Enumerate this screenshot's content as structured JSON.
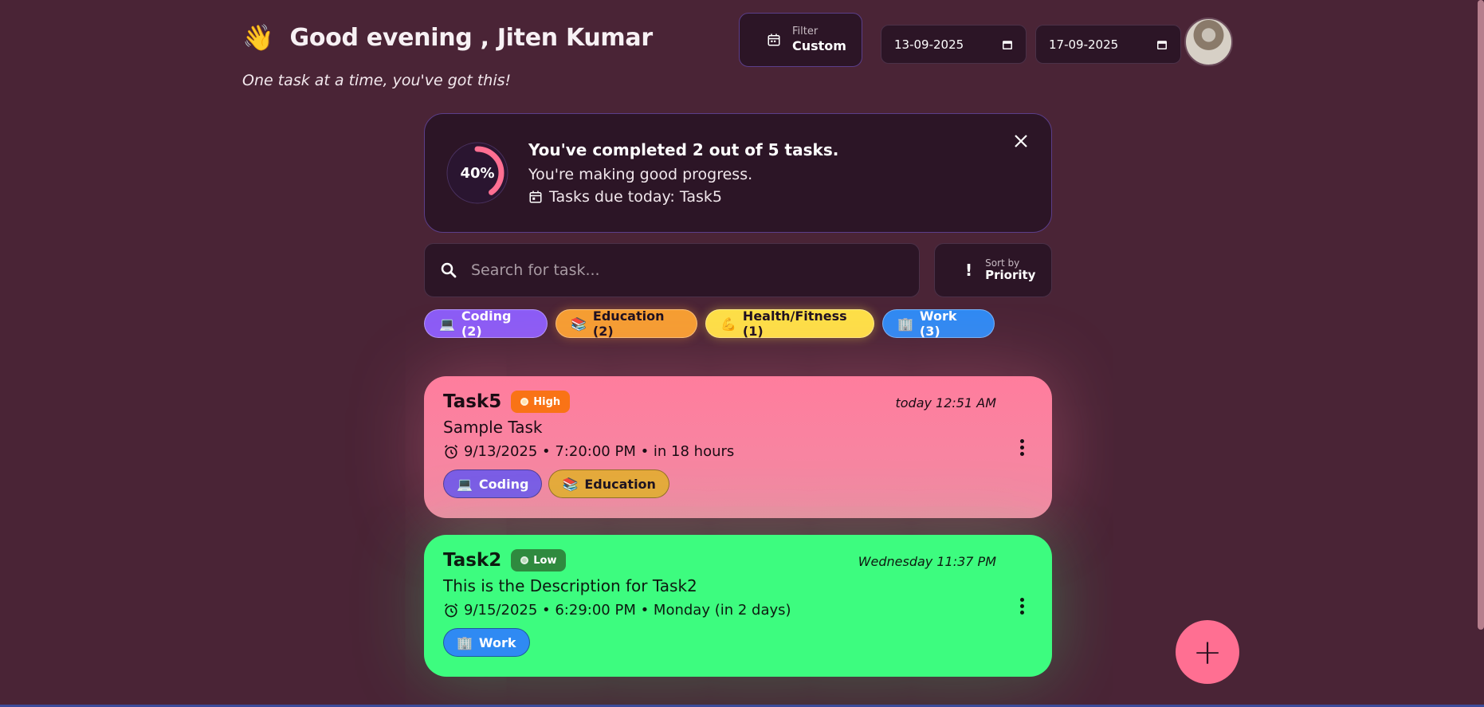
{
  "header": {
    "wave_emoji": "👋",
    "greeting": "Good evening , Jiten Kumar",
    "subtitle": "One task at a time, you've got this!",
    "filter": {
      "caption": "Filter",
      "value": "Custom"
    },
    "start_date": "13-09-2025",
    "end_date": "17-09-2025"
  },
  "progress": {
    "percent": "40%",
    "percent_value": 0.4,
    "completed_text": "You've completed 2 out of 5 tasks.",
    "message": "You're making good progress.",
    "due_today": "Tasks due today: Task5"
  },
  "search": {
    "placeholder": "Search for task..."
  },
  "sort": {
    "caption": "Sort by",
    "value": "Priority"
  },
  "categories": [
    {
      "emoji": "💻",
      "label": "Coding (2)"
    },
    {
      "emoji": "📚",
      "label": "Education (2)"
    },
    {
      "emoji": "💪",
      "label": "Health/Fitness (1)"
    },
    {
      "emoji": "🏢",
      "label": "Work (3)"
    }
  ],
  "tasks": [
    {
      "title": "Task5",
      "priority": "High",
      "time": "today 12:51 AM",
      "description": "Sample Task",
      "due": "9/13/2025 • 7:20:00 PM • in 18 hours",
      "tags": [
        {
          "emoji": "💻",
          "label": "Coding"
        },
        {
          "emoji": "📚",
          "label": "Education"
        }
      ]
    },
    {
      "title": "Task2",
      "priority": "Low",
      "time": "Wednesday 11:37 PM",
      "description": "This is the Description for Task2",
      "due": "9/15/2025 • 6:29:00 PM • Monday (in 2 days)",
      "tags": [
        {
          "emoji": "🏢",
          "label": "Work"
        }
      ]
    }
  ],
  "fab_label": "+",
  "colors": {
    "background": "#4a2436",
    "card": "#2c1526",
    "high_task": "#ff7d9d",
    "low_task": "#3dfc7f",
    "accent": "#ff6f92"
  }
}
